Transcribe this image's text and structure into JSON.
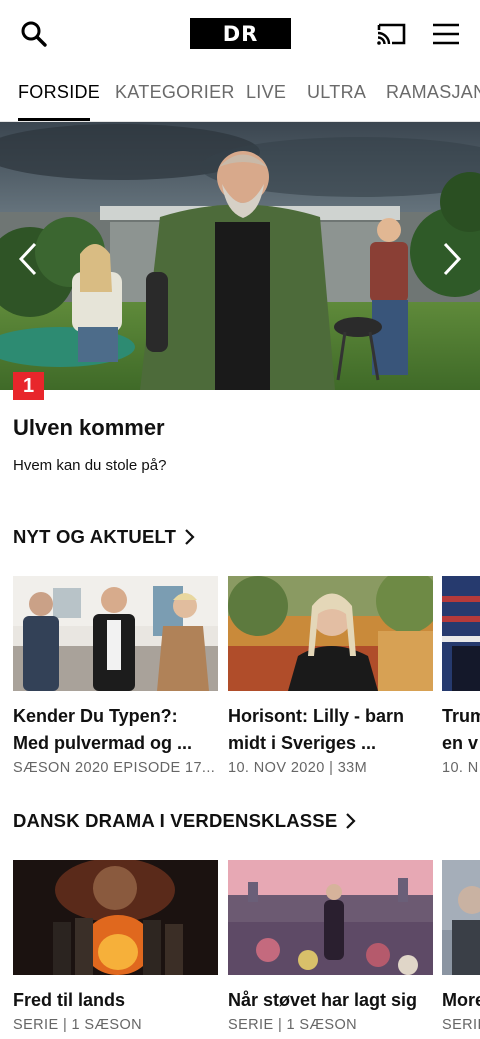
{
  "header": {
    "logo_text": "DR",
    "icons": [
      "search-icon",
      "cast-icon",
      "menu-icon"
    ]
  },
  "tabs": [
    {
      "label": "FORSIDE",
      "active": true
    },
    {
      "label": "KATEGORIER",
      "active": false
    },
    {
      "label": "LIVE",
      "active": false
    },
    {
      "label": "ULTRA",
      "active": false
    },
    {
      "label": "RAMASJANG",
      "active": false
    }
  ],
  "hero": {
    "channel_badge": "1",
    "title": "Ulven kommer",
    "subtitle": "Hvem kan du stole på?"
  },
  "sections": [
    {
      "title": "NYT OG AKTUELT",
      "cards": [
        {
          "title_line1": "Kender Du Typen?:",
          "title_line2": "Med pulvermad og ...",
          "meta": "SÆSON 2020 EPISODE 17..."
        },
        {
          "title_line1": "Horisont: Lilly - barn",
          "title_line2": "midt i Sveriges ...",
          "meta": "10. NOV 2020 | 33M"
        },
        {
          "title_line1": "Trum",
          "title_line2": "en v",
          "meta": "10. N"
        }
      ]
    },
    {
      "title": "DANSK DRAMA I VERDENSKLASSE",
      "cards": [
        {
          "title_line1": "Fred til lands",
          "meta": "SERIE | 1 SÆSON"
        },
        {
          "title_line1": "Når støvet har lagt sig",
          "meta": "SERIE | 1 SÆSON"
        },
        {
          "title_line1": "More",
          "meta": "SERIE"
        }
      ]
    }
  ],
  "colors": {
    "accent_red": "#e8262b",
    "text_primary": "#111111",
    "text_secondary": "#666666",
    "tab_inactive": "#6a6a6a"
  }
}
